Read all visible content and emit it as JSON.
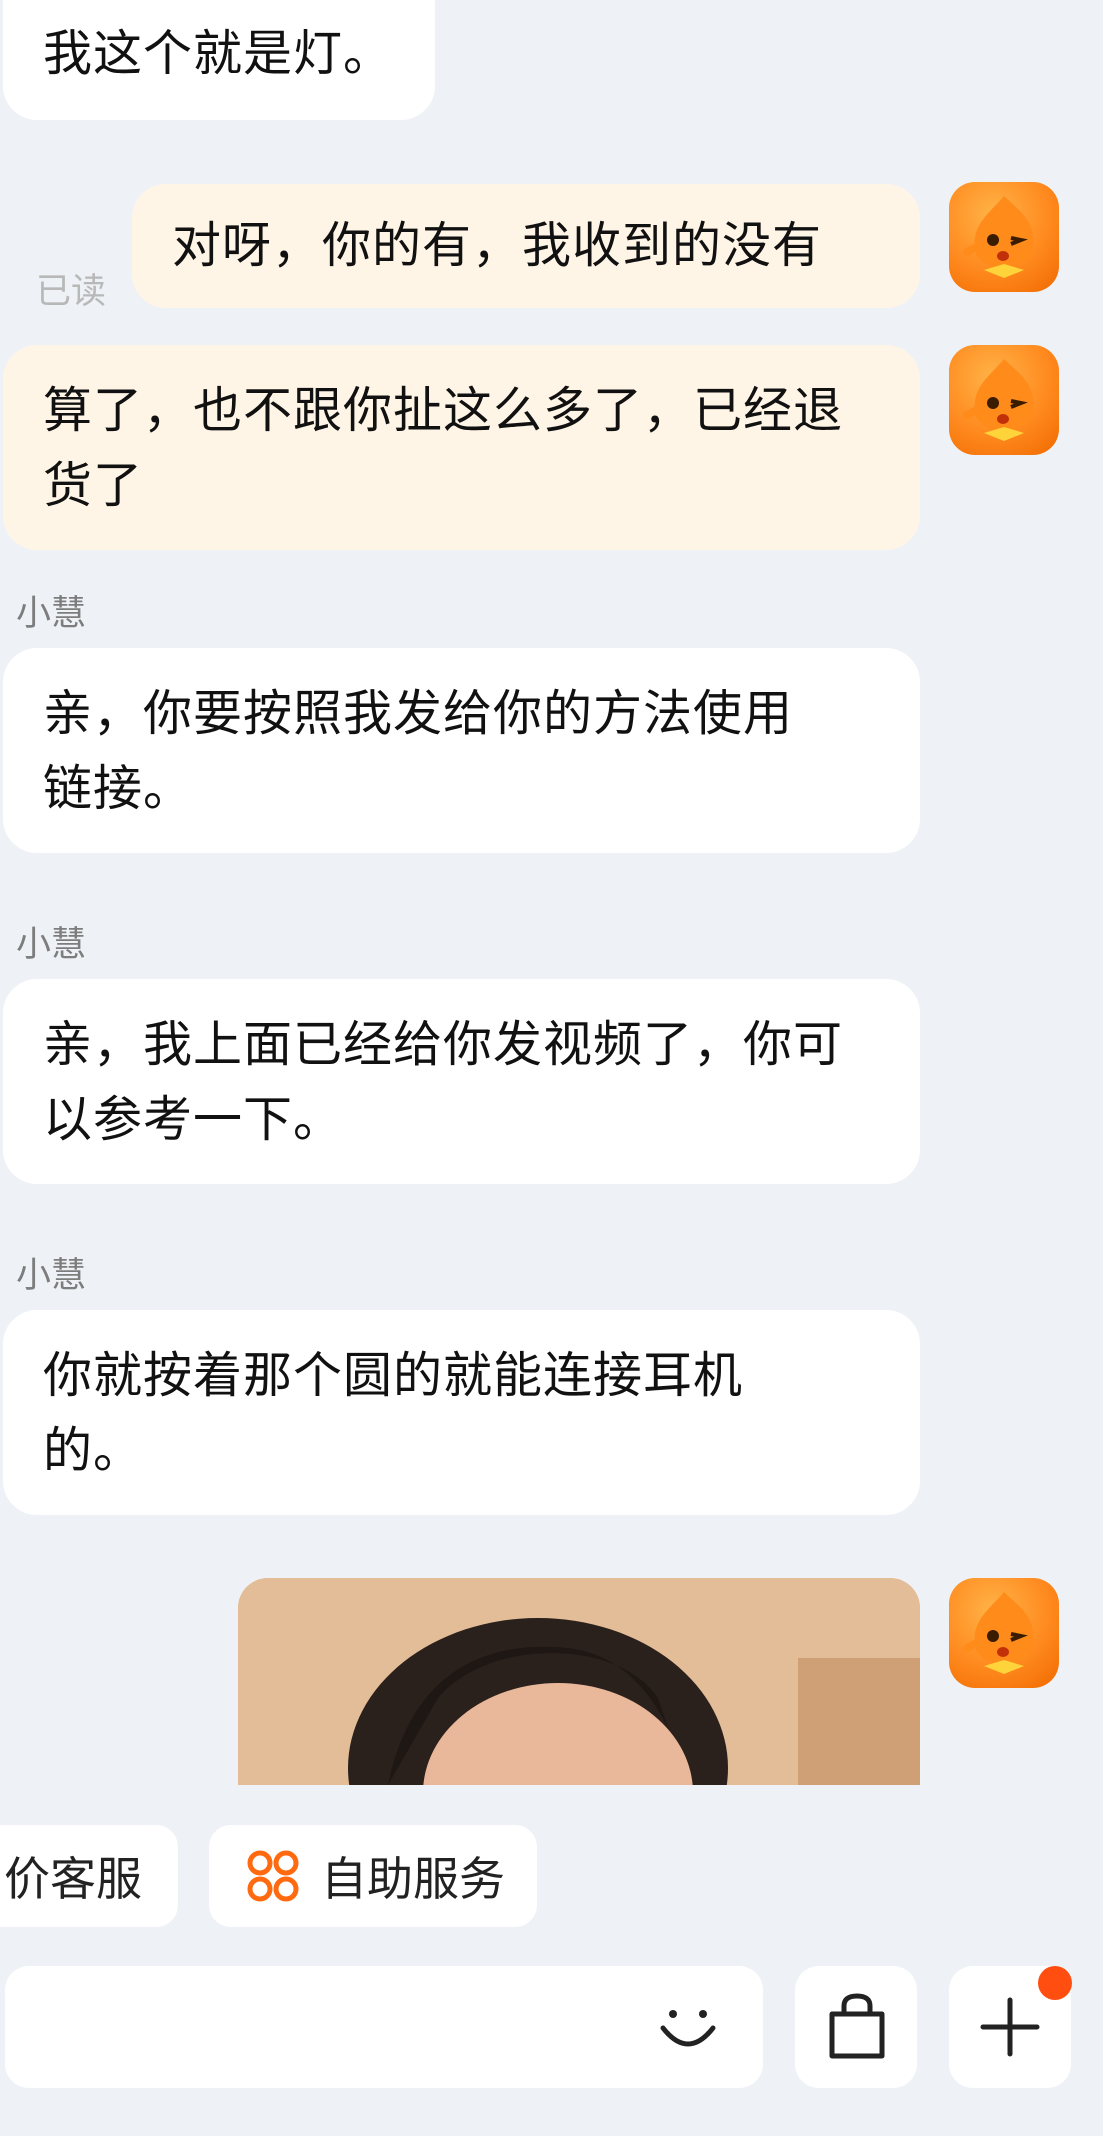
{
  "messages": [
    {
      "side": "in",
      "text": "我这个就是灯。"
    },
    {
      "side": "out",
      "text": "对呀，你的有，我收到的没有",
      "status": "已读"
    },
    {
      "side": "out",
      "text": "算了，也不跟你扯这么多了，已经退货了"
    },
    {
      "side": "in",
      "sender": "小慧",
      "text": "亲，你要按照我发给你的方法使用链接。"
    },
    {
      "side": "in",
      "sender": "小慧",
      "text": "亲，我上面已经给你发视频了，你可以参考一下。"
    },
    {
      "side": "in",
      "sender": "小慧",
      "text": "你就按着那个圆的就能连接耳机的。"
    },
    {
      "side": "out",
      "type": "image"
    }
  ],
  "quick_actions": [
    {
      "label": "价客服"
    },
    {
      "label": "自助服务",
      "icon": "four-circles-icon"
    }
  ],
  "input_bar": {
    "placeholder": "",
    "emoji_icon": "smile-icon",
    "shop_icon": "shopping-bag-icon",
    "more_icon": "plus-icon",
    "badge_color": "#ff4e10"
  },
  "colors": {
    "background": "#eef2f7",
    "incoming": "#ffffff",
    "outgoing": "#fff5e6",
    "accent": "#ff6a10"
  }
}
